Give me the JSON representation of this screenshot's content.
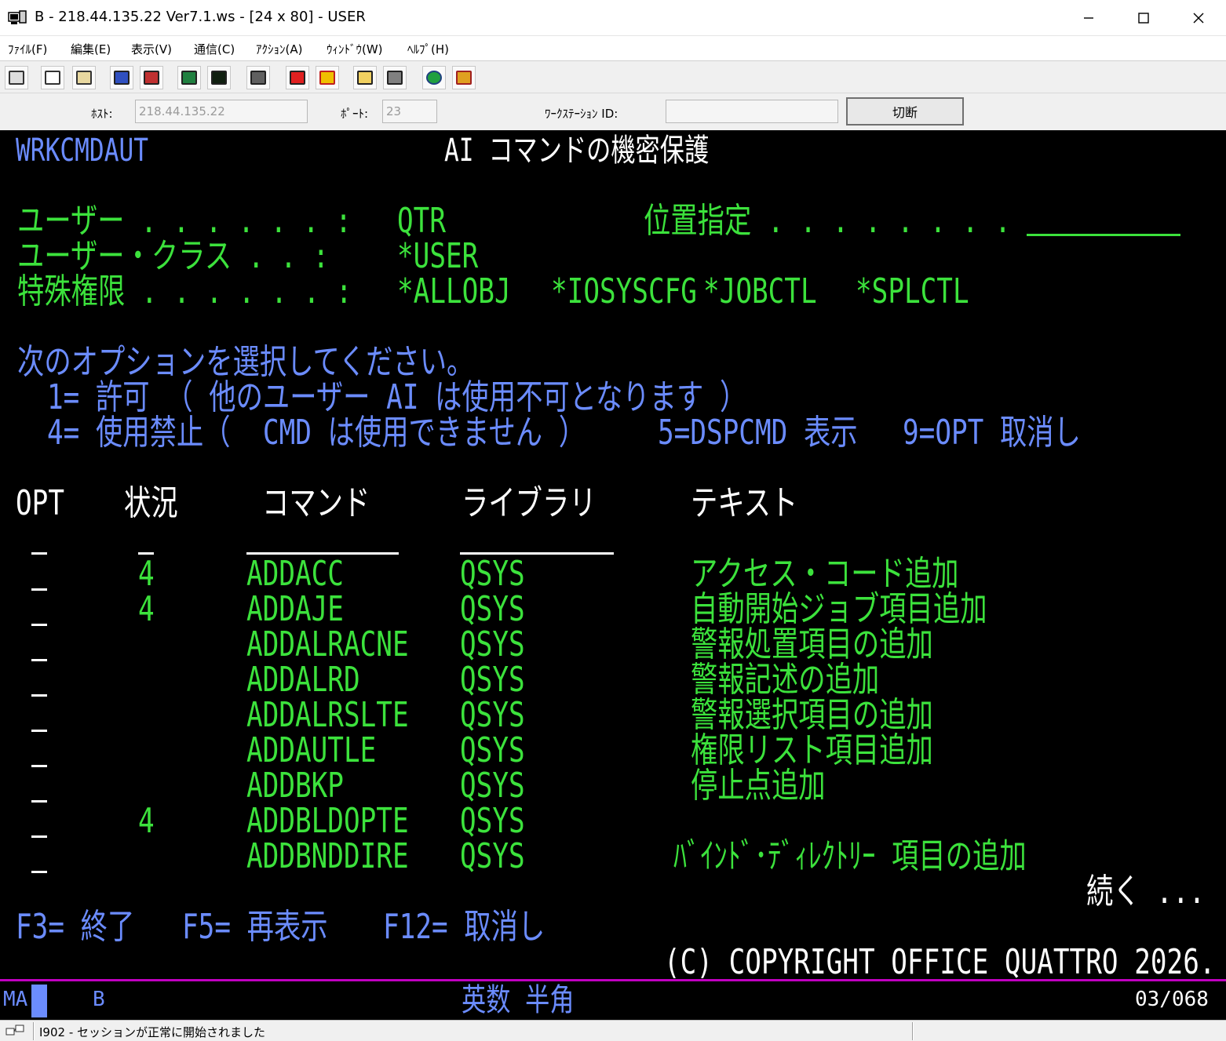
{
  "window": {
    "title": "B - 218.44.135.22 Ver7.1.ws - [24 x 80] - USER",
    "min_icon": "minimize-icon",
    "max_icon": "maximize-icon",
    "close_icon": "close-icon"
  },
  "menu": [
    "ﾌｧｲﾙ(F)",
    "編集(E)",
    "表示(V)",
    "通信(C)",
    "ｱｸｼｮﾝ(A)",
    "ｳｨﾝﾄﾞｳ(W)",
    "ﾍﾙﾌﾟ(H)"
  ],
  "connection": {
    "host_label": "ﾎｽﾄ:",
    "host_value": "218.44.135.22",
    "port_label": "ﾎﾟｰﾄ:",
    "port_value": "23",
    "ws_label": "ﾜｰｸｽﾃｰｼｮﾝ ID:",
    "ws_value": "",
    "disconnect_label": "切断"
  },
  "screen": {
    "program": "WRKCMDAUT",
    "title": "AI コマンドの機密保護",
    "user_label": "ユーザー . . . . . . :",
    "user_value": "QTR",
    "position_label": "位置指定 . . . . . . . .",
    "userclass_label": "ユーザー・クラス . . :",
    "userclass_value": "*USER",
    "special_label": "特殊権限 . . . . . . :",
    "special_values": [
      "*ALLOBJ",
      "*IOSYSCFG",
      "*JOBCTL",
      "*SPLCTL"
    ],
    "instruction": "次のオプションを選択してください。",
    "option_line1": "1= 許可 （ 他のユーザー AI は使用不可となります ）",
    "option_line2a": "4= 使用禁止（  CMD は使用できません ）",
    "option_line2b": "5=DSPCMD 表示",
    "option_line2c": "9=OPT 取消し",
    "headers": {
      "opt": "OPT",
      "status": "状況",
      "command": "コマンド",
      "library": "ライブラリ",
      "text": "テキスト"
    },
    "rows": [
      {
        "opt": "_",
        "status": "4",
        "command": "ADDACC",
        "library": "QSYS",
        "text": "アクセス・コード追加"
      },
      {
        "opt": "_",
        "status": "4",
        "command": "ADDAJE",
        "library": "QSYS",
        "text": "自動開始ジョブ項目追加"
      },
      {
        "opt": "_",
        "status": "",
        "command": "ADDALRACNE",
        "library": "QSYS",
        "text": "警報処置項目の追加"
      },
      {
        "opt": "_",
        "status": "",
        "command": "ADDALRD",
        "library": "QSYS",
        "text": "警報記述の追加"
      },
      {
        "opt": "_",
        "status": "",
        "command": "ADDALRSLTE",
        "library": "QSYS",
        "text": "警報選択項目の追加"
      },
      {
        "opt": "_",
        "status": "",
        "command": "ADDAUTLE",
        "library": "QSYS",
        "text": "権限リスト項目追加"
      },
      {
        "opt": "_",
        "status": "",
        "command": "ADDBKP",
        "library": "QSYS",
        "text": "停止点追加"
      },
      {
        "opt": "_",
        "status": "4",
        "command": "ADDBLDOPTE",
        "library": "QSYS",
        "text": ""
      },
      {
        "opt": "_",
        "status": "",
        "command": "ADDBNDDIRE",
        "library": "QSYS",
        "text": "ﾊﾞｲﾝﾄﾞ･ﾃﾞｨﾚｸﾄﾘｰ 項目の追加"
      }
    ],
    "more": "続く ...",
    "fkeys": [
      "F3= 終了",
      "F5= 再表示",
      "F12= 取消し"
    ],
    "copyright": "(C) COPYRIGHT OFFICE QUATTRO 2026."
  },
  "oia": {
    "indicator": "MA",
    "session": "B",
    "mode": "英数 半角",
    "cursor_pos": "03/068"
  },
  "status": {
    "message": "I902 - セッションが正常に開始されました"
  }
}
